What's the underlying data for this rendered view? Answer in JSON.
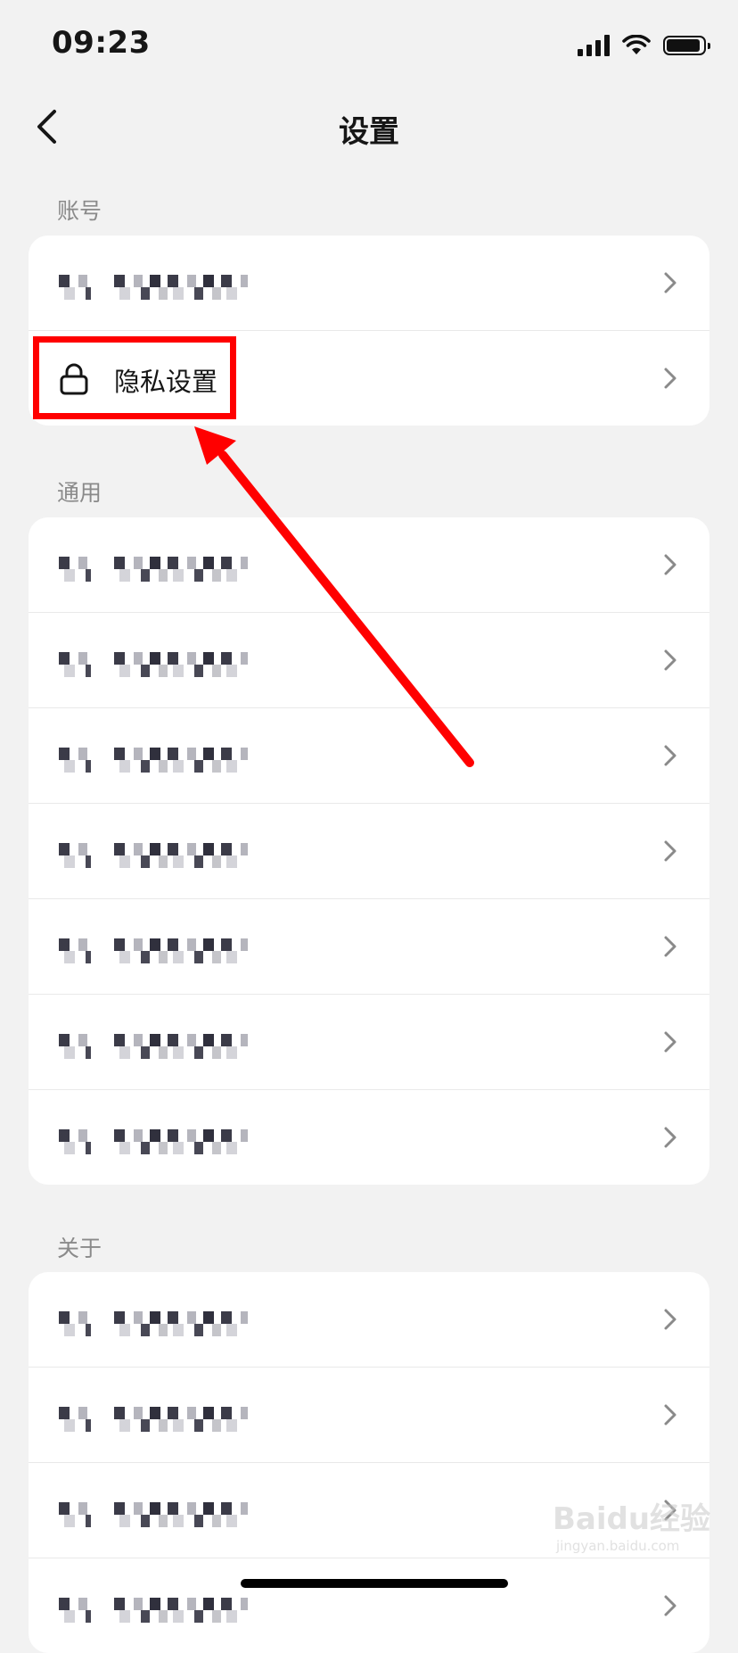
{
  "status_bar": {
    "time": "09:23",
    "battery_level": 0.92
  },
  "nav": {
    "title": "设置"
  },
  "sections": {
    "account": {
      "label": "账号",
      "rows": [
        {
          "label": "",
          "obscured": true
        },
        {
          "label": "隐私设置",
          "icon": "lock-icon",
          "obscured": false
        }
      ]
    },
    "general": {
      "label": "通用",
      "rows_obscured": 7
    },
    "about": {
      "label": "关于",
      "rows_obscured": 4
    }
  },
  "annotation": {
    "color": "#ff0000",
    "target": "隐私设置"
  },
  "watermark": {
    "brand": "Baidu经验",
    "domain": "jingyan.baidu.com"
  }
}
